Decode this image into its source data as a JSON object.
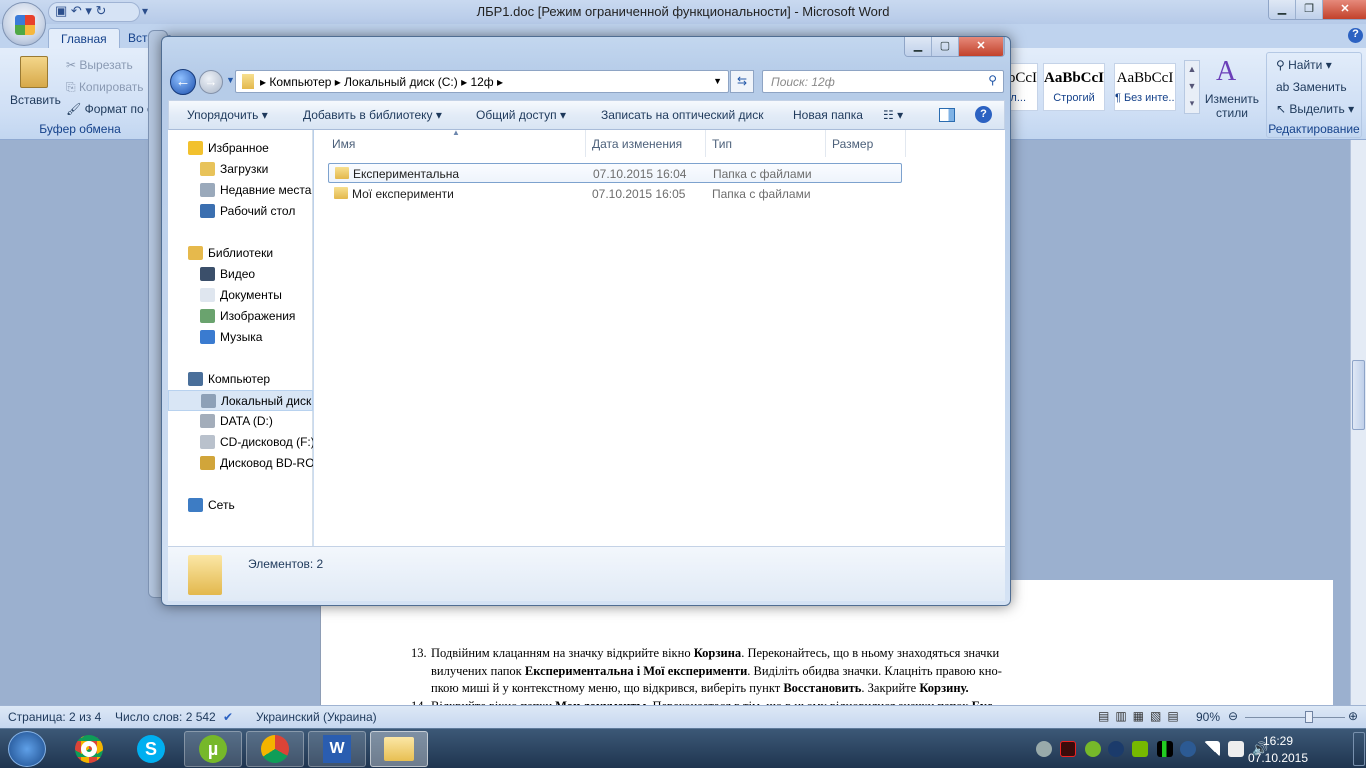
{
  "word": {
    "title": "ЛБР1.doc [Режим ограниченной функциональности] - Microsoft Word",
    "tabs": [
      "Главная",
      "Вставка"
    ],
    "clipboard": {
      "paste": "Вставить",
      "cut": "Вырезать",
      "copy": "Копировать",
      "format": "Формат по образцу",
      "group": "Буфер обмена"
    },
    "styles": [
      {
        "sample": "AaBbCcI",
        "name": "Загол..."
      },
      {
        "sample": "AaBbCcI",
        "name": "Строгий"
      },
      {
        "sample": "AaBbCcI",
        "name": "¶ Без инте..."
      }
    ],
    "change_styles": "Изменить стили",
    "editing": {
      "find": "Найти",
      "replace": "Заменить",
      "select": "Выделить",
      "group": "Редактирование"
    },
    "doc_lines": [
      {
        "num": "13.",
        "parts": [
          [
            "Подвійним клацанням на значку відкрийте вікно ",
            0
          ],
          [
            "Корзина",
            1
          ],
          [
            ". Переконайтесь, що в ньому знаходяться значки",
            0
          ]
        ]
      },
      {
        "num": "",
        "parts": [
          [
            "вилучених папок ",
            0
          ],
          [
            "Експериментальна і Мої експерименти",
            1
          ],
          [
            ". Виділіть обидва значки. Клацніть правою кно-",
            0
          ]
        ]
      },
      {
        "num": "",
        "parts": [
          [
            "пкою миші й у контекстному меню, що відкрився, виберіть пункт ",
            0
          ],
          [
            "Восстановить",
            1
          ],
          [
            ". Закрийте ",
            0
          ],
          [
            "Корзину.",
            1
          ]
        ]
      },
      {
        "num": "14.",
        "parts": [
          [
            "Відкрийте вікно папки ",
            0
          ],
          [
            "Мои документы",
            1
          ],
          [
            ". Переконаетеся в тім, що в ньому відновилися значки папок ",
            0
          ],
          [
            "Екс-",
            1
          ]
        ]
      }
    ],
    "status": {
      "page": "Страница: 2 из 4",
      "words": "Число слов: 2 542",
      "lang": "Украинский (Украина)",
      "zoom": "90%"
    },
    "zoom_percent": 90
  },
  "explorer": {
    "breadcrumb": [
      "Компьютер",
      "Локальный диск (C:)",
      "12ф"
    ],
    "search_placeholder": "Поиск: 12ф",
    "toolbar": [
      "Упорядочить",
      "Добавить в библиотеку",
      "Общий доступ",
      "Записать на оптический диск",
      "Новая папка"
    ],
    "nav": [
      {
        "label": "Избранное",
        "level": 0,
        "color": "#f2c12e"
      },
      {
        "label": "Загрузки",
        "level": 1,
        "color": "#e8c35a"
      },
      {
        "label": "Недавние места",
        "level": 1,
        "color": "#9aa9bb"
      },
      {
        "label": "Рабочий стол",
        "level": 1,
        "color": "#3b6fb0"
      },
      {
        "label": "Библиотеки",
        "level": 0,
        "color": "#e6b94c"
      },
      {
        "label": "Видео",
        "level": 1,
        "color": "#3b4f6a"
      },
      {
        "label": "Документы",
        "level": 1,
        "color": "#dfe6ef"
      },
      {
        "label": "Изображения",
        "level": 1,
        "color": "#6aa36e"
      },
      {
        "label": "Музыка",
        "level": 1,
        "color": "#3a7bd0"
      },
      {
        "label": "Компьютер",
        "level": 0,
        "color": "#4a6f9a"
      },
      {
        "label": "Локальный диск (C:)",
        "level": 1,
        "color": "#8da0b7",
        "selected": true
      },
      {
        "label": "DATA (D:)",
        "level": 1,
        "color": "#a3adba"
      },
      {
        "label": "CD-дисковод (F:)",
        "level": 1,
        "color": "#b9c1cc"
      },
      {
        "label": "Дисковод BD-ROM",
        "level": 1,
        "color": "#d1a53a"
      },
      {
        "label": "Сеть",
        "level": 0,
        "color": "#3d7cc4"
      }
    ],
    "columns": [
      "Имя",
      "Дата изменения",
      "Тип",
      "Размер"
    ],
    "files": [
      {
        "name": "Експериментальна",
        "date": "07.10.2015 16:04",
        "type": "Папка с файлами",
        "size": ""
      },
      {
        "name": "Мої експерименти",
        "date": "07.10.2015 16:05",
        "type": "Папка с файлами",
        "size": ""
      }
    ],
    "details": "Элементов: 2"
  },
  "taskbar": {
    "time": "16:29",
    "date": "07.10.2015"
  }
}
